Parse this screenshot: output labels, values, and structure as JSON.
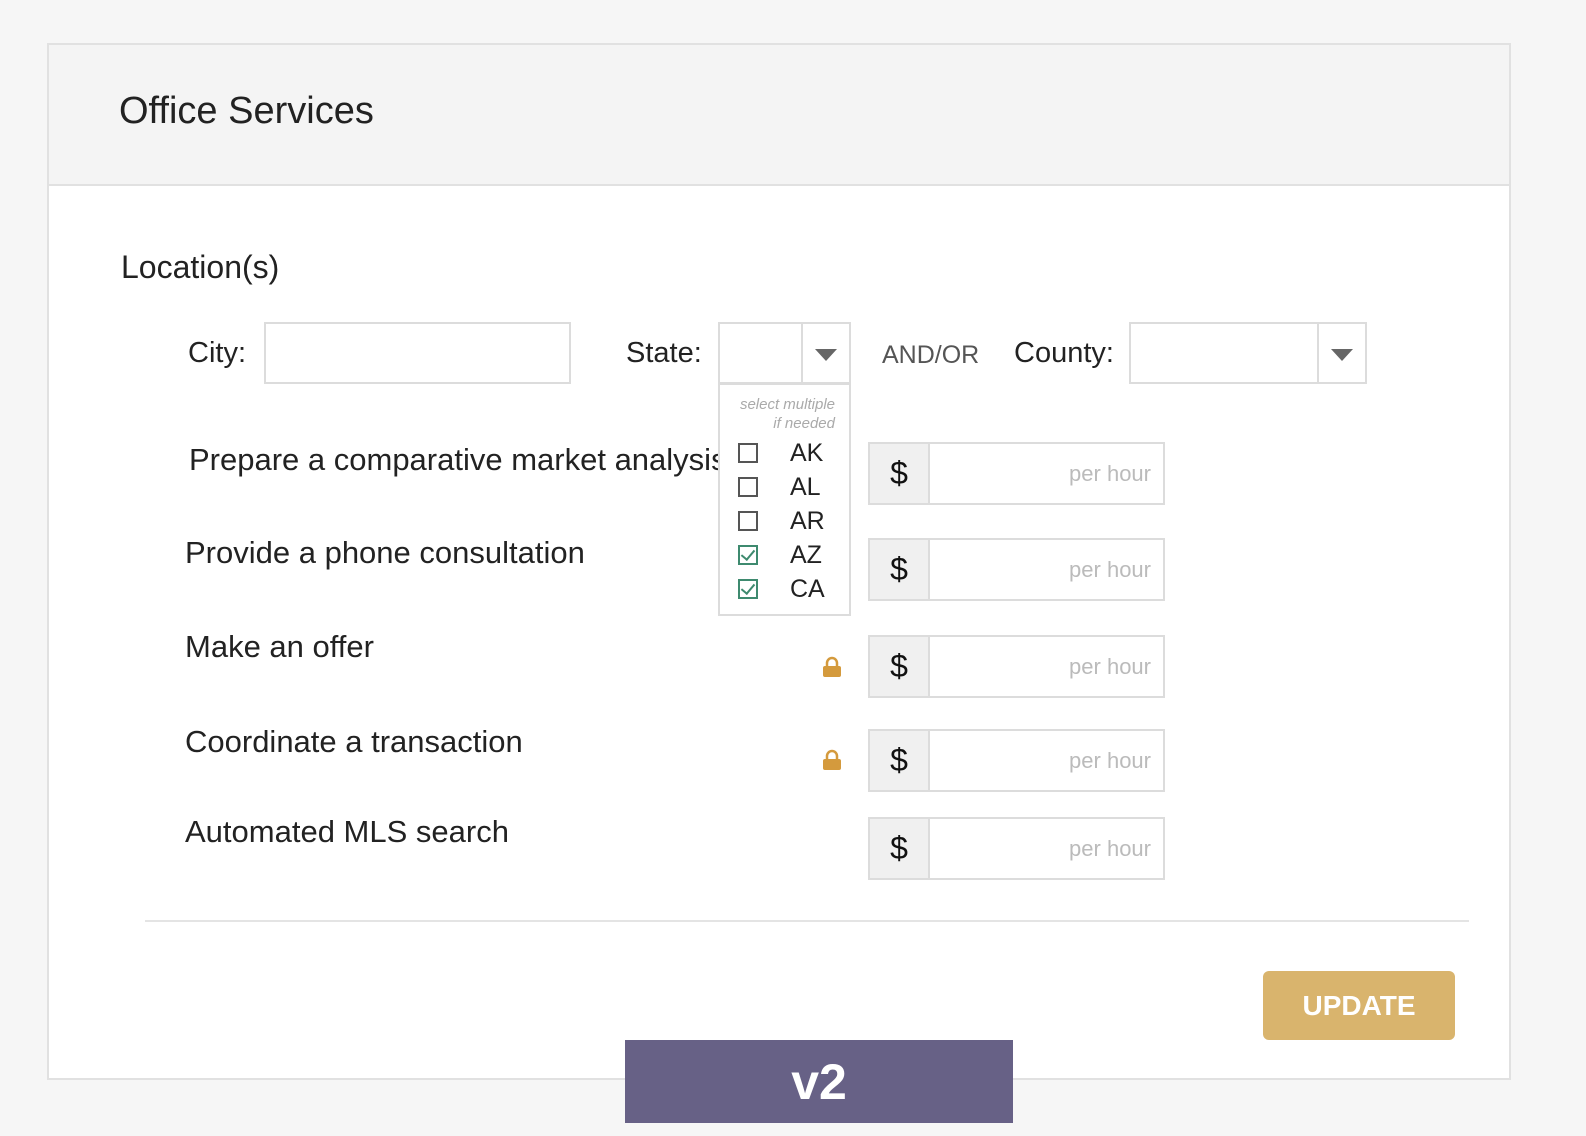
{
  "header": {
    "title": "Office Services"
  },
  "location": {
    "section_label": "Location(s)",
    "city_label": "City:",
    "city_value": "",
    "state_label": "State:",
    "state_value": "",
    "andor_label": "AND/OR",
    "county_label": "County:",
    "county_value": ""
  },
  "state_dropdown": {
    "hint_line1": "select multiple",
    "hint_line2": "if needed",
    "options": [
      {
        "label": "AK",
        "checked": false
      },
      {
        "label": "AL",
        "checked": false
      },
      {
        "label": "AR",
        "checked": false
      },
      {
        "label": "AZ",
        "checked": true
      },
      {
        "label": "CA",
        "checked": true
      }
    ]
  },
  "services": [
    {
      "label": "Prepare a comparative market analysis",
      "currency": "$",
      "placeholder": "per hour",
      "locked": false
    },
    {
      "label": "Provide a phone consultation",
      "currency": "$",
      "placeholder": "per hour",
      "locked": false
    },
    {
      "label": "Make an offer",
      "currency": "$",
      "placeholder": "per hour",
      "locked": true
    },
    {
      "label": "Coordinate a transaction",
      "currency": "$",
      "placeholder": "per hour",
      "locked": true
    },
    {
      "label": "Automated MLS search",
      "currency": "$",
      "placeholder": "per hour",
      "locked": false
    }
  ],
  "actions": {
    "update_label": "UPDATE"
  },
  "badge": {
    "version": "v2"
  },
  "icons": {
    "lock": "lock-icon",
    "dropdown": "chevron-down-icon",
    "check": "checkmark-icon"
  },
  "colors": {
    "accent": "#d9b46d",
    "lock": "#d49a3d",
    "check": "#3e8a6f",
    "badge": "#676186"
  }
}
